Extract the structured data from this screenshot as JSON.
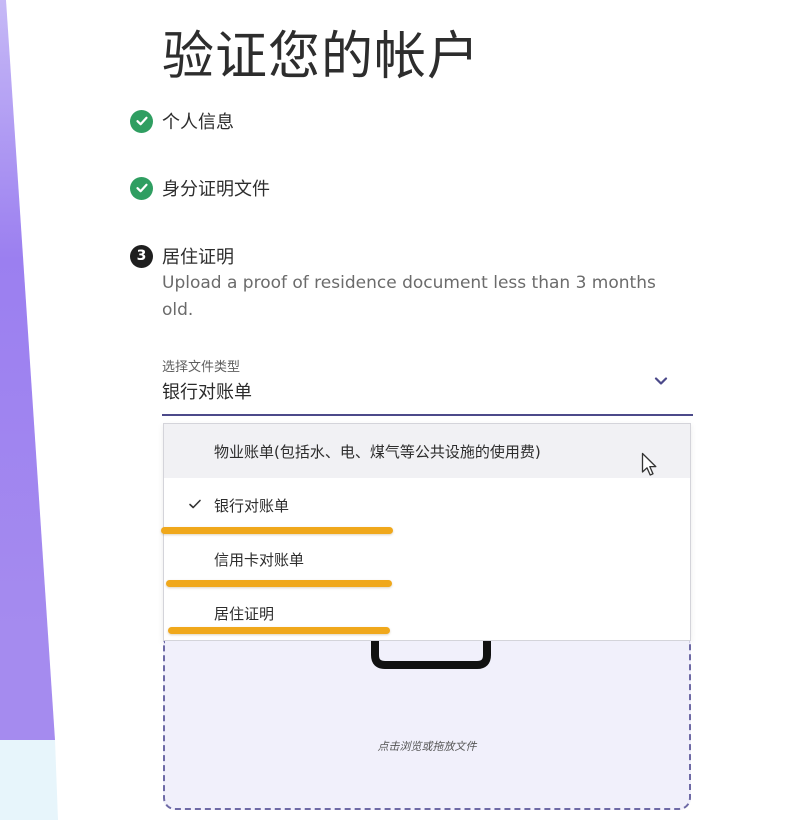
{
  "page": {
    "title": "验证您的帐户"
  },
  "steps": [
    {
      "status": "done",
      "label": "个人信息",
      "icon": "check-circle-icon"
    },
    {
      "status": "done",
      "label": "身分证明文件",
      "icon": "check-circle-icon"
    },
    {
      "status": "current",
      "number": "3",
      "label": "居住证明",
      "description": "Upload a proof of residence document less than 3 months old."
    }
  ],
  "document_type": {
    "label": "选择文件类型",
    "selected_value": "银行对账单",
    "chevron_icon": "chevron-down-icon",
    "options": [
      {
        "label": "物业账单(包括水、电、煤气等公共设施的使用费)",
        "selected": false,
        "hovered": true
      },
      {
        "label": "银行对账单",
        "selected": true,
        "hovered": false
      },
      {
        "label": "信用卡对账单",
        "selected": false,
        "hovered": false
      },
      {
        "label": "居住证明",
        "selected": false,
        "hovered": false
      }
    ]
  },
  "dropzone": {
    "text": "点击浏览或拖放文件",
    "icon": "upload-tray-icon"
  },
  "colors": {
    "success_green": "#2f9e61",
    "accent_purple": "#4c4a8a",
    "highlight_orange": "#f0a81b",
    "dropzone_bg": "#f1f0fb",
    "decor_purple": "#a58bef"
  }
}
